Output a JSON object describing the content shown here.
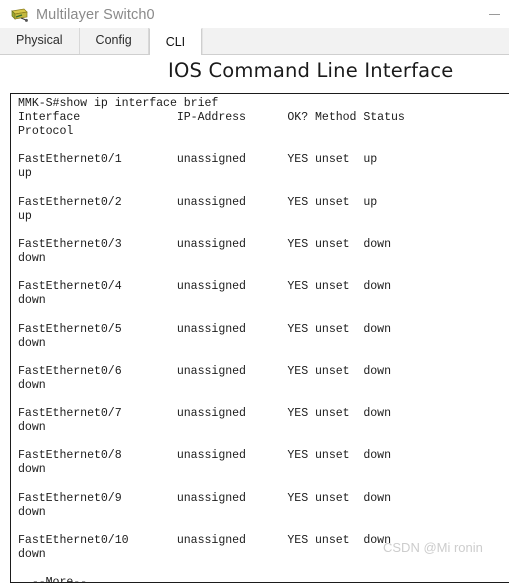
{
  "window": {
    "title": "Multilayer Switch0",
    "icon": "switch-device-icon",
    "minimize_label": "—"
  },
  "tabs": [
    {
      "label": "Physical",
      "active": false
    },
    {
      "label": "Config",
      "active": false
    },
    {
      "label": "CLI",
      "active": true
    }
  ],
  "panel": {
    "heading": "IOS Command Line Interface"
  },
  "terminal": {
    "prompt_line": "MMK-S#show ip interface brief",
    "header_line_1": "Interface              IP-Address      OK? Method Status",
    "header_line_2": "Protocol",
    "more_prompt": "  --More--",
    "lines": [
      "MMK-S#show ip interface brief",
      "Interface              IP-Address      OK? Method Status",
      "Protocol",
      "",
      "FastEthernet0/1        unassigned      YES unset  up",
      "up",
      "",
      "FastEthernet0/2        unassigned      YES unset  up",
      "up",
      "",
      "FastEthernet0/3        unassigned      YES unset  down",
      "down",
      "",
      "FastEthernet0/4        unassigned      YES unset  down",
      "down",
      "",
      "FastEthernet0/5        unassigned      YES unset  down",
      "down",
      "",
      "FastEthernet0/6        unassigned      YES unset  down",
      "down",
      "",
      "FastEthernet0/7        unassigned      YES unset  down",
      "down",
      "",
      "FastEthernet0/8        unassigned      YES unset  down",
      "down",
      "",
      "FastEthernet0/9        unassigned      YES unset  down",
      "down",
      "",
      "FastEthernet0/10       unassigned      YES unset  down",
      "down",
      "",
      "  --More--"
    ],
    "interfaces": [
      {
        "name": "FastEthernet0/1",
        "ip_address": "unassigned",
        "ok": "YES",
        "method": "unset",
        "status": "up",
        "protocol": "up"
      },
      {
        "name": "FastEthernet0/2",
        "ip_address": "unassigned",
        "ok": "YES",
        "method": "unset",
        "status": "up",
        "protocol": "up"
      },
      {
        "name": "FastEthernet0/3",
        "ip_address": "unassigned",
        "ok": "YES",
        "method": "unset",
        "status": "down",
        "protocol": "down"
      },
      {
        "name": "FastEthernet0/4",
        "ip_address": "unassigned",
        "ok": "YES",
        "method": "unset",
        "status": "down",
        "protocol": "down"
      },
      {
        "name": "FastEthernet0/5",
        "ip_address": "unassigned",
        "ok": "YES",
        "method": "unset",
        "status": "down",
        "protocol": "down"
      },
      {
        "name": "FastEthernet0/6",
        "ip_address": "unassigned",
        "ok": "YES",
        "method": "unset",
        "status": "down",
        "protocol": "down"
      },
      {
        "name": "FastEthernet0/7",
        "ip_address": "unassigned",
        "ok": "YES",
        "method": "unset",
        "status": "down",
        "protocol": "down"
      },
      {
        "name": "FastEthernet0/8",
        "ip_address": "unassigned",
        "ok": "YES",
        "method": "unset",
        "status": "down",
        "protocol": "down"
      },
      {
        "name": "FastEthernet0/9",
        "ip_address": "unassigned",
        "ok": "YES",
        "method": "unset",
        "status": "down",
        "protocol": "down"
      },
      {
        "name": "FastEthernet0/10",
        "ip_address": "unassigned",
        "ok": "YES",
        "method": "unset",
        "status": "down",
        "protocol": "down"
      }
    ]
  },
  "watermark": {
    "text": "CSDN @Mi ronin"
  },
  "colors": {
    "title_text": "#8a8a8a",
    "tab_active_bg": "#ffffff",
    "tab_inactive_bg": "#f2f2f2",
    "terminal_border": "#1b1b1b",
    "terminal_text": "#1c1c1c",
    "watermark": "#cdcdcd"
  }
}
